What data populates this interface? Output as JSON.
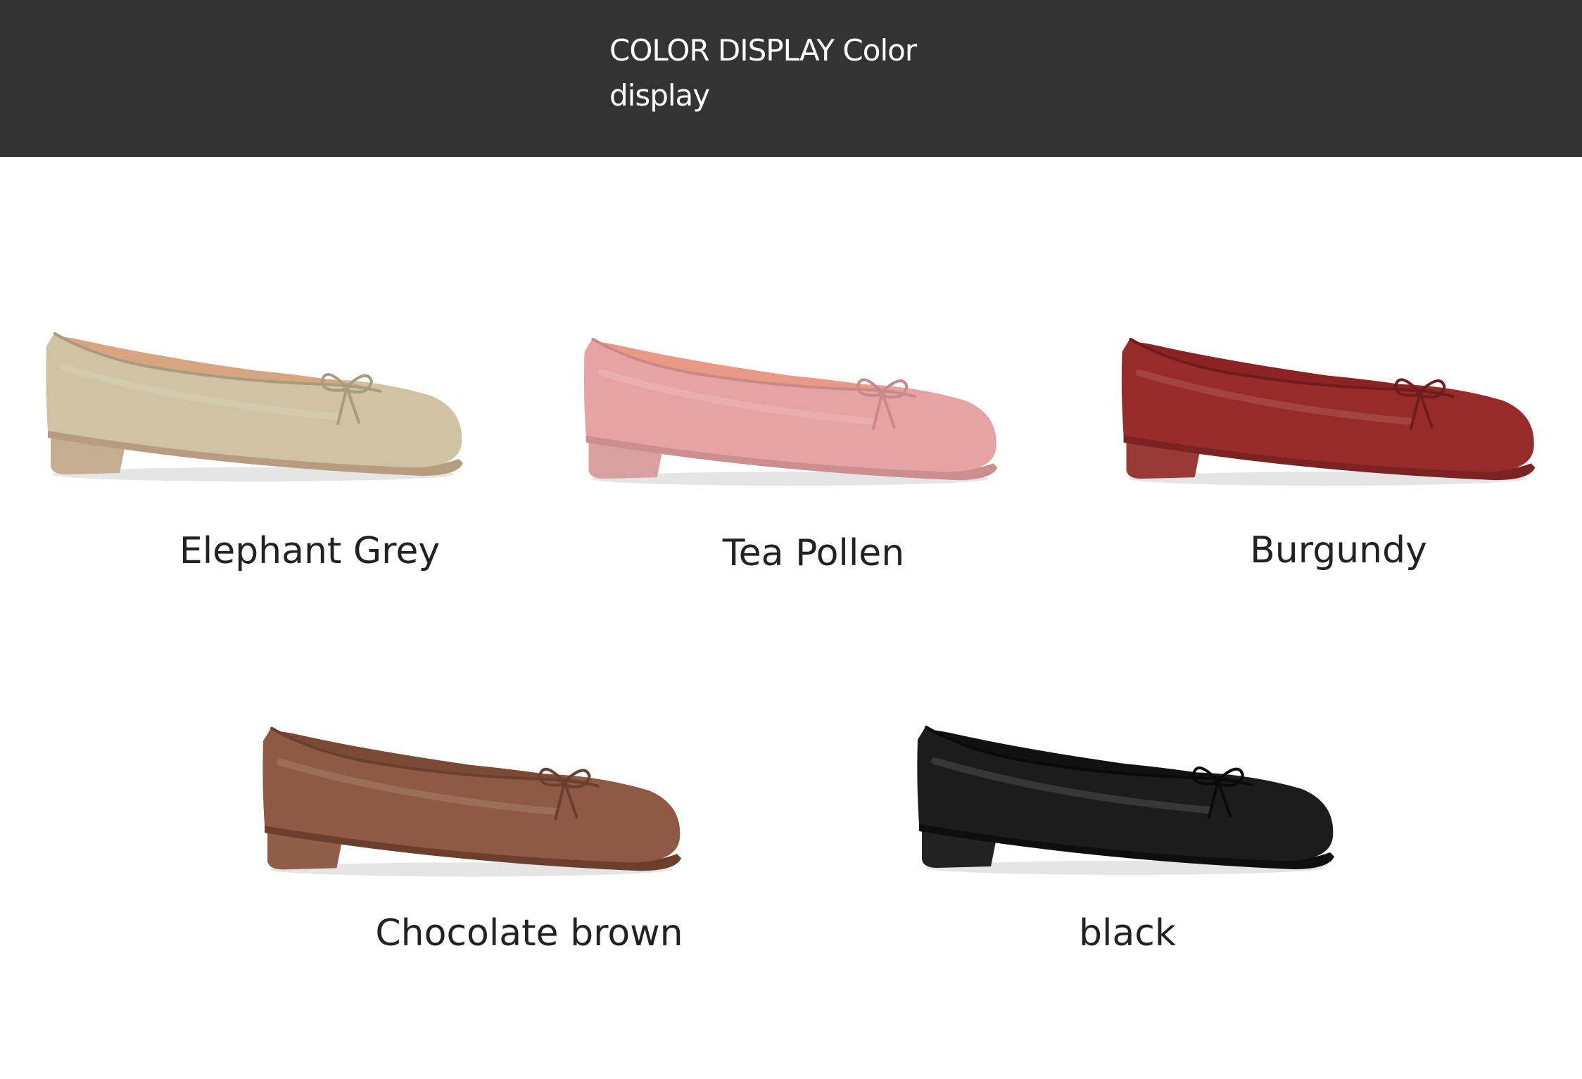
{
  "header": {
    "title_line1": "COLOR DISPLAY Color",
    "title_line2": "display"
  },
  "colors": [
    {
      "label": "Elephant Grey",
      "upper": "#cfc3a3",
      "lining": "#d8a582",
      "sole": "#b89c80",
      "heel": "#c4ad90",
      "bow": "#a89c7e"
    },
    {
      "label": "Tea Pollen",
      "upper": "#e6a3a4",
      "lining": "#e99a86",
      "sole": "#cc8e8e",
      "heel": "#d8a09e",
      "bow": "#c98988"
    },
    {
      "label": "Burgundy",
      "upper": "#972b2a",
      "lining": "#8a2322",
      "sole": "#7a2322",
      "heel": "#9a3a36",
      "bow": "#6f1c1c"
    },
    {
      "label": "Chocolate brown",
      "upper": "#8f5a44",
      "lining": "#7b4a36",
      "sole": "#6b3e2e",
      "heel": "#8e5e48",
      "bow": "#6a3f2f"
    },
    {
      "label": "black",
      "upper": "#1c1c1c",
      "lining": "#111111",
      "sole": "#0e0e0e",
      "heel": "#222222",
      "bow": "#0a0a0a"
    }
  ]
}
